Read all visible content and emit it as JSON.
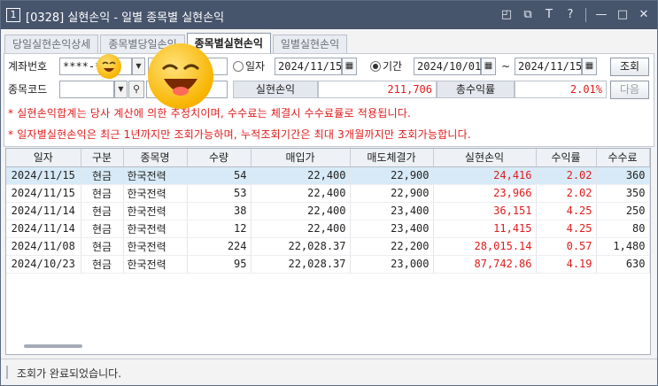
{
  "window": {
    "screen_no": "1",
    "title": "[0328] 실현손익 - 일별 종목별 실현손익",
    "titlebar_icons": [
      "restore-icon",
      "pin-icon",
      "font-size-icon",
      "help-icon",
      "minimize-icon",
      "maximize-icon",
      "close-icon"
    ],
    "titlebar_glyphs": {
      "restore": "◰",
      "pin": "⧉",
      "font": "T",
      "help": "?",
      "min": "—",
      "max": "□",
      "close": "✕"
    }
  },
  "tabs": [
    {
      "label": "당일실현손익상세",
      "active": false
    },
    {
      "label": "종목별당일손익",
      "active": false
    },
    {
      "label": "종목별실현손익",
      "active": true
    },
    {
      "label": "일별실현손익",
      "active": false
    }
  ],
  "form": {
    "account_label": "계좌번호",
    "account_value": "****-**",
    "code_label": "종목코드",
    "code_value": "",
    "radio_date_label": "일자",
    "radio_period_label": "기간",
    "date_single": "2024/11/15",
    "period_from": "2024/10/01",
    "period_sep": "~",
    "period_to": "2024/11/15",
    "search_button": "조회",
    "next_button": "다음",
    "realized_label": "실현손익",
    "realized_value": "211,706",
    "total_return_label": "총수익률",
    "total_return_value": "2.01%"
  },
  "notes": [
    "* 실현손익합계는 당사 계산에 의한 추정치이며, 수수료는 체결시 수수료률로 적용됩니다.",
    "* 일자별실현손익은 최근 1년까지만 조회가능하며, 누적조회기간은 최대 3개월까지만 조회가능합니다."
  ],
  "grid": {
    "columns": [
      "일자",
      "구분",
      "종목명",
      "수량",
      "매입가",
      "매도체결가",
      "실현손익",
      "수익률",
      "수수료"
    ],
    "rows": [
      [
        "2024/11/15",
        "현금",
        "한국전력",
        "54",
        "22,400",
        "22,900",
        "24,416",
        "2.02",
        "360"
      ],
      [
        "2024/11/15",
        "현금",
        "한국전력",
        "53",
        "22,400",
        "22,900",
        "23,966",
        "2.02",
        "350"
      ],
      [
        "2024/11/14",
        "현금",
        "한국전력",
        "38",
        "22,400",
        "23,400",
        "36,151",
        "4.25",
        "250"
      ],
      [
        "2024/11/14",
        "현금",
        "한국전력",
        "12",
        "22,400",
        "23,400",
        "11,415",
        "4.25",
        "80"
      ],
      [
        "2024/11/08",
        "현금",
        "한국전력",
        "224",
        "22,028.37",
        "22,200",
        "28,015.14",
        "0.57",
        "1,480"
      ],
      [
        "2024/10/23",
        "현금",
        "한국전력",
        "95",
        "22,028.37",
        "23,000",
        "87,742.86",
        "4.19",
        "630"
      ]
    ]
  },
  "status": {
    "message": "조회가 완료되었습니다."
  },
  "colors": {
    "titlebar": "#46546c",
    "profit": "#e01b1b",
    "selected_row": "#d8eaf7"
  }
}
